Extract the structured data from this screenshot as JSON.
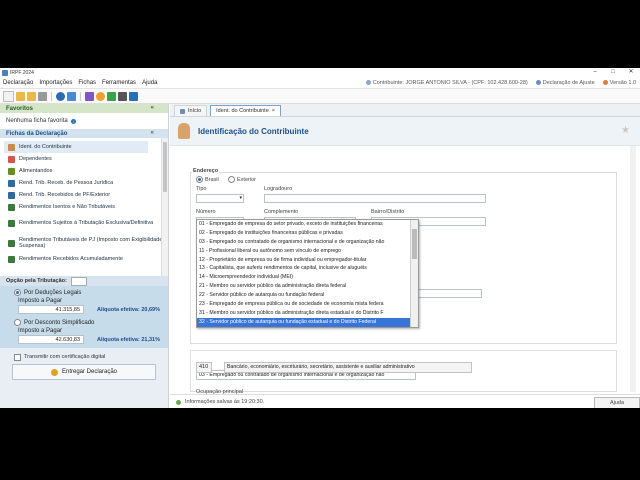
{
  "window": {
    "title": "IRPF 2024"
  },
  "menu": [
    "Declaração",
    "Importações",
    "Fichas",
    "Ferramentas",
    "Ajuda"
  ],
  "top_right": {
    "contribuinte": "Contribuinte: JORGE ANTONIO SILVA - (CPF: 102.428.600-28)",
    "declaracao": "Declaração de Ajuste",
    "versao": "Versão 1.0"
  },
  "sidebar": {
    "favoritos_title": "Favoritos",
    "favoritos_empty": "Nenhuma ficha favorita",
    "fichas_title": "Fichas da Declaração",
    "items": [
      {
        "label": "Ident. do Contribuinte",
        "color": "#c98a4a"
      },
      {
        "label": "Dependentes",
        "color": "#d9534f"
      },
      {
        "label": "Alimentandos",
        "color": "#6b8e23"
      },
      {
        "label": "Rend. Trib. Receb. de Pessoa Jurídica",
        "color": "#2d6aa3"
      },
      {
        "label": "Rend. Trib. Recebidos de PF/Exterior",
        "color": "#2d6aa3"
      },
      {
        "label": "Rendimentos Isentos e Não Tributáveis",
        "color": "#3b7a3b"
      },
      {
        "label": "Rendimentos Sujeitos à Tributação Exclusiva/Definitiva",
        "color": "#3b7a3b"
      },
      {
        "label": "Rendimentos Tributáveis de PJ (Imposto com Exigibilidade Suspensa)",
        "color": "#3b7a3b"
      },
      {
        "label": "Rendimentos Recebidos Acumuladamente",
        "color": "#3b7a3b"
      }
    ]
  },
  "opcao": {
    "title": "Opção pela Tributação:",
    "deducoes_label": "Por Deduções Legais",
    "deducoes_imposto_label": "Imposto a Pagar",
    "deducoes_value": "41.315,85",
    "deducoes_aliq": "Alíquota efetiva: 20,69%",
    "simplificado_label": "Por Desconto Simplificado",
    "simplificado_imposto_label": "Imposto a Pagar",
    "simplificado_value": "42.630,83",
    "simplificado_aliq": "Alíquota efetiva: 21,31%",
    "transmitir": "Transmitir com certificação digital",
    "entregar": "Entregar Declaração"
  },
  "tabs": [
    {
      "label": "Início"
    },
    {
      "label": "Ident. do Contribuinte",
      "close": "×"
    }
  ],
  "page_title": "Identificação do Contribuinte",
  "form": {
    "endereco": "Endereço",
    "brasil": "Brasil",
    "exterior": "Exterior",
    "tipo": "Tipo",
    "logradouro": "Logradouro",
    "numero": "Número",
    "complemento": "Complemento",
    "bairro": "Bairro/Distrito",
    "ocupacao_selected": "03 - Empregado ou contratado de organismo internacional e de organização não",
    "ocupacao_principal": "Ocupação principal",
    "ocupacao_code": "410",
    "ocupacao_desc": "Bancário, economiário, escriturário, secretário, assistente e auxiliar administrativo"
  },
  "dropdown_options": [
    "01 - Empregado de empresa do setor privado, exceto de instituições financeiras",
    "02 - Empregado de instituições financeiras públicas e privadas",
    "03 - Empregado ou contratado de organismo internacional e de organização não",
    "11 - Profissional liberal ou autônomo sem vínculo de emprego",
    "12 - Proprietário de empresa ou de firma individual ou empregador-titular",
    "13 - Capitalista, que auferiu rendimentos de capital, inclusive de aluguéis",
    "14 - Microempreendedor individual (MEI)",
    "21 - Membro ou servidor público da administração direta federal",
    "22 - Servidor público de autarquia ou fundação federal",
    "23 - Empregado de empresa pública ou de sociedade de economia mista federa",
    "31 - Membro ou servidor público da administração direta estadual e do Distrito F",
    "32 - Servidor público de autarquia ou fundação estadual e do Distrito Federal"
  ],
  "dropdown_selected_index": 11,
  "status": {
    "saved": "Informações salvas às 19:20:30.",
    "ajuda": "Ajuda"
  }
}
